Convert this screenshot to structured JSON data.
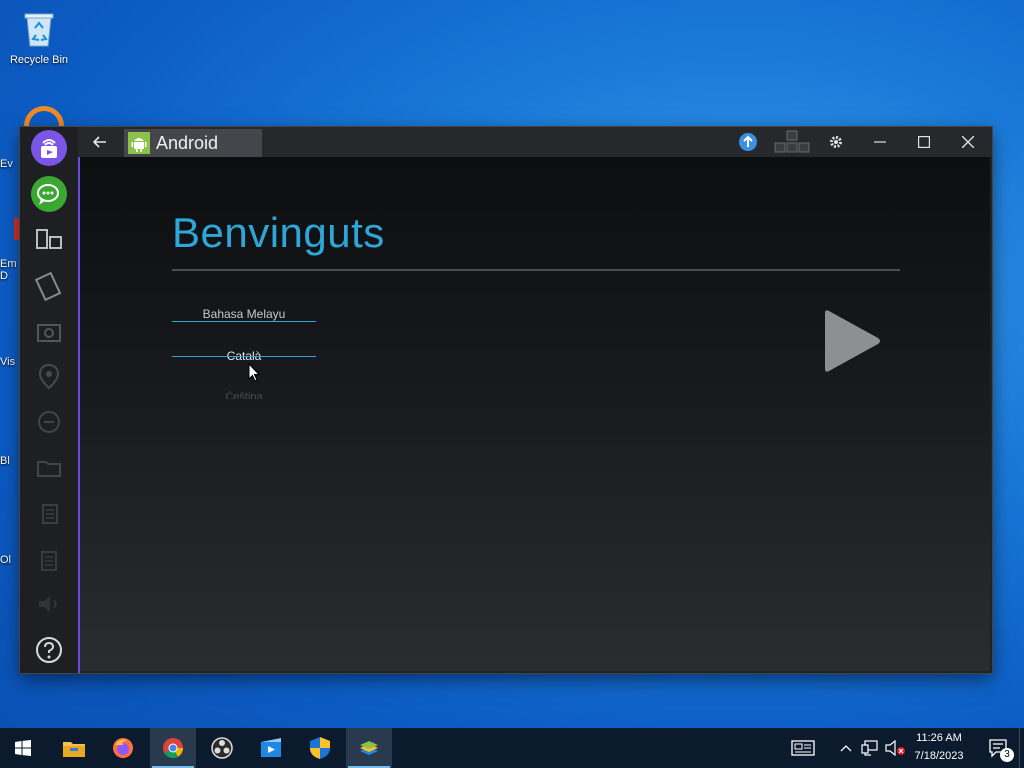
{
  "desktop": {
    "recycle_bin_label": "Recycle Bin",
    "partial_labels": [
      "Ev",
      "Em\nD",
      "Vis",
      "Bl",
      "Ol"
    ]
  },
  "window": {
    "title": "Android",
    "back_icon": "back-arrow-icon",
    "controls": [
      "upload-icon",
      "keyboard-mapping-icon",
      "gear-icon",
      "minimize-icon",
      "maximize-icon",
      "close-icon"
    ]
  },
  "sidebar": {
    "items": [
      "cast-icon",
      "chat-icon",
      "multi-instance-icon",
      "rotate-icon",
      "screenshot-icon",
      "location-icon",
      "shake-icon",
      "folder-icon",
      "copy-icon",
      "paste-icon",
      "volume-icon",
      "help-icon"
    ]
  },
  "android": {
    "heading": "Benvinguts",
    "languages": [
      "Bahasa Melayu",
      "Català",
      "Čeština"
    ],
    "next_icon": "play-icon"
  },
  "taskbar": {
    "apps": [
      "start-icon",
      "file-explorer-icon",
      "firefox-icon",
      "chrome-icon",
      "obs-icon",
      "media-player-icon",
      "security-icon",
      "bluestacks-icon"
    ],
    "time": "11:26 AM",
    "date": "7/18/2023",
    "notification_count": "3"
  },
  "colors": {
    "accent": "#2ea6d8",
    "sidebar_border": "#6a4ad8",
    "desktop_blue": "#1a7ad9"
  }
}
